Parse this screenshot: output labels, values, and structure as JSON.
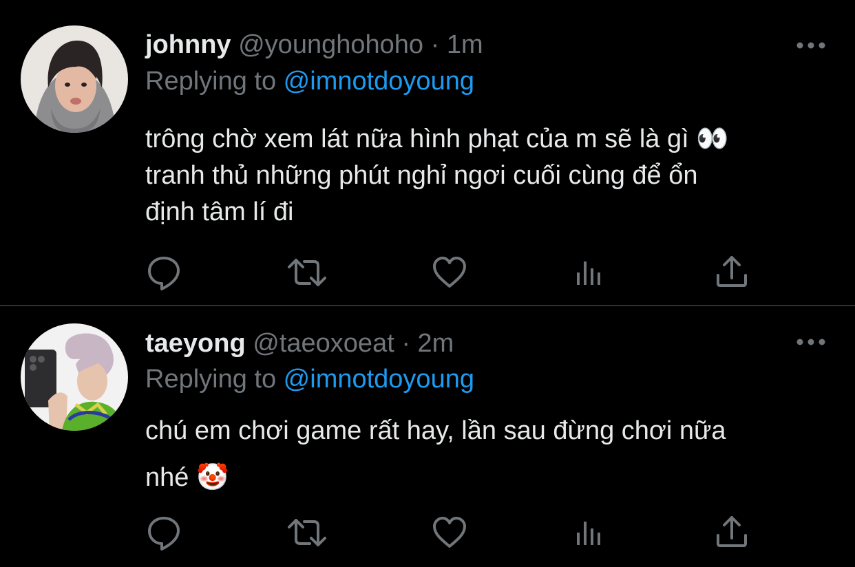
{
  "tweets": [
    {
      "name": "johnny",
      "handle": "@younghohoho",
      "separator": "·",
      "time": "1m",
      "replying_prefix": "Replying to ",
      "replying_to": "@imnotdoyoung",
      "text": "trông chờ xem lát nữa hình phạt của m sẽ là gì 👀\ntranh thủ những phút nghỉ ngơi cuối cùng để ổn\nđịnh tâm lí đi",
      "avatar_icon": "avatar-photo-hooded-man"
    },
    {
      "name": "taeyong",
      "handle": "@taeoxoeat",
      "separator": "·",
      "time": "2m",
      "replying_prefix": "Replying to ",
      "replying_to": "@imnotdoyoung",
      "text": "chú em chơi game rất hay, lần sau đừng chơi nữa\nnhé 🤡",
      "avatar_icon": "avatar-photo-mirror-selfie"
    }
  ],
  "actions": [
    {
      "name": "reply",
      "icon": "reply-icon"
    },
    {
      "name": "retweet",
      "icon": "retweet-icon"
    },
    {
      "name": "like",
      "icon": "heart-icon"
    },
    {
      "name": "analytics",
      "icon": "analytics-icon"
    },
    {
      "name": "share",
      "icon": "share-icon"
    }
  ],
  "colors": {
    "background": "#000000",
    "text_primary": "#e7e9ea",
    "text_secondary": "#71767b",
    "accent": "#1d9bf0",
    "divider": "#2f3336"
  }
}
